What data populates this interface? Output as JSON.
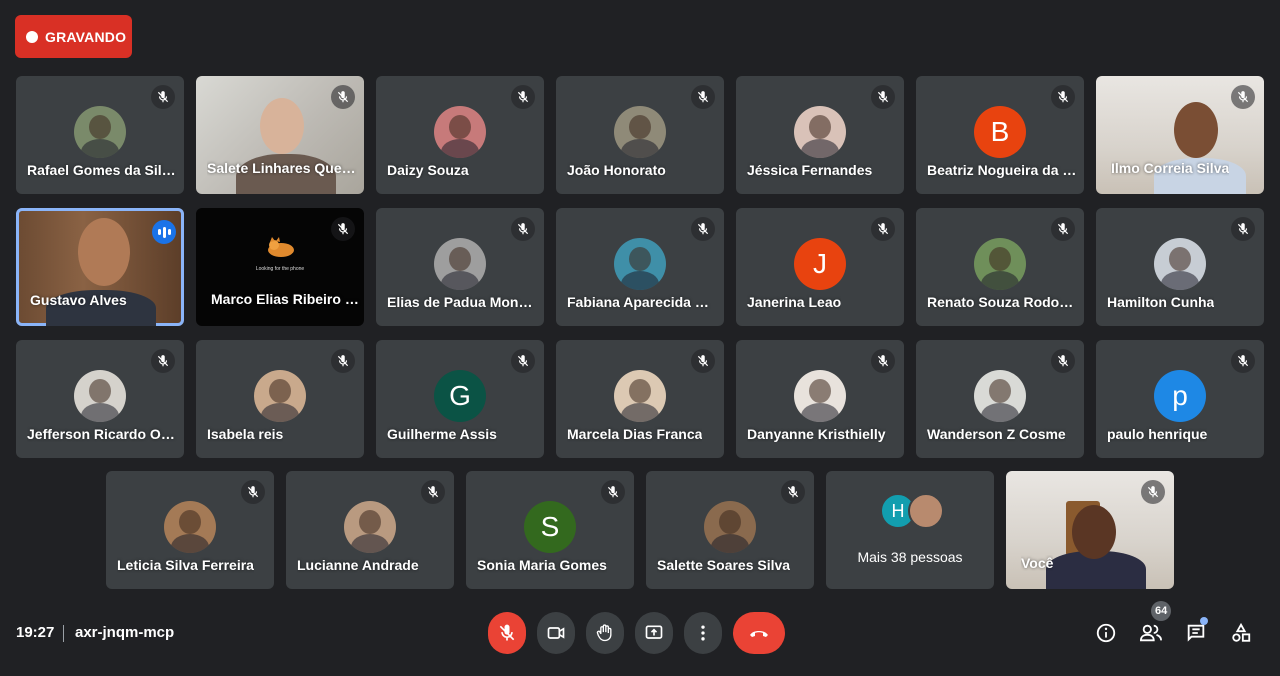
{
  "recording": {
    "label": "GRAVANDO",
    "color": "#d93025"
  },
  "participants": [
    {
      "name": "Rafael Gomes da Silve…"
    },
    {
      "name": "Salete Linhares Queir…"
    },
    {
      "name": "Daizy Souza"
    },
    {
      "name": "João Honorato"
    },
    {
      "name": "Jéssica Fernandes"
    },
    {
      "name": "Beatriz Nogueira da C…",
      "initial": "B",
      "color": "#e8430f"
    },
    {
      "name": "Ilmo Correia Silva"
    },
    {
      "name": "Gustavo Alves"
    },
    {
      "name": "Marco Elias Ribeiro Si…",
      "video_text": "Looking for the phone"
    },
    {
      "name": "Elias de Padua Monteiro"
    },
    {
      "name": "Fabiana Aparecida Ma…"
    },
    {
      "name": "Janerina Leao",
      "initial": "J",
      "color": "#e8430f"
    },
    {
      "name": "Renato Souza Rodoval…"
    },
    {
      "name": "Hamilton Cunha"
    },
    {
      "name": "Jefferson Ricardo Oliv…"
    },
    {
      "name": "Isabela reis"
    },
    {
      "name": "Guilherme Assis",
      "initial": "G",
      "color": "#0b5345"
    },
    {
      "name": "Marcela Dias Franca"
    },
    {
      "name": "Danyanne Kristhielly"
    },
    {
      "name": "Wanderson Z Cosme"
    },
    {
      "name": "paulo henrique",
      "initial": "p",
      "color": "#1e88e5"
    },
    {
      "name": "Leticia Silva Ferreira"
    },
    {
      "name": "Lucianne Andrade"
    },
    {
      "name": "Sonia Maria Gomes",
      "initial": "S",
      "color": "#33691e"
    },
    {
      "name": "Salette Soares Silva"
    },
    {
      "name": "Você"
    }
  ],
  "more": {
    "initial": "H",
    "label": "Mais 38 pessoas"
  },
  "footer": {
    "time": "19:27",
    "meeting_code": "axr-jnqm-mcp",
    "people_count": "64"
  },
  "controls": {
    "mic": "mic-off-icon",
    "camera": "camera-icon",
    "hand": "raise-hand-icon",
    "present": "present-screen-icon",
    "more": "more-options-icon",
    "end": "end-call-icon"
  },
  "right_icons": [
    "info-icon",
    "people-icon",
    "chat-icon",
    "activities-icon"
  ]
}
